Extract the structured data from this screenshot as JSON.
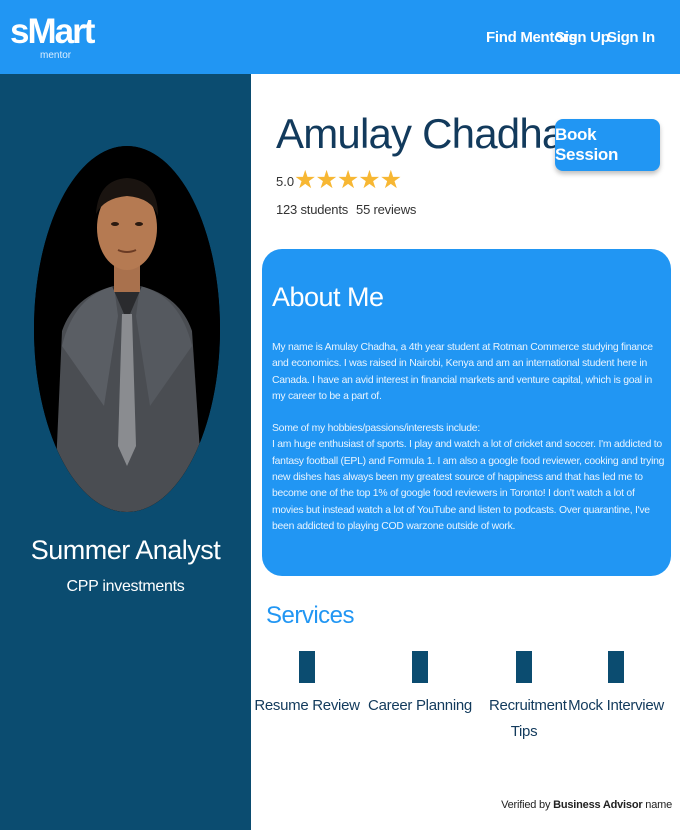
{
  "brand": {
    "logo_main": "sMart",
    "logo_sub": "mentor"
  },
  "nav": {
    "find_mentors": "Find Mentors",
    "sign_up": "Sign Up",
    "sign_in": "Sign In"
  },
  "colors": {
    "primary": "#2196f3",
    "sidebar": "#0b4c70",
    "star": "#f7b733",
    "heading": "#123a5c"
  },
  "sidebar": {
    "role_title": "Summer Analyst",
    "company": "CPP investments"
  },
  "profile": {
    "name": "Amulay Chadha",
    "rating": "5.0",
    "stars": "★★★★★",
    "star_count": 5,
    "students": "123 students",
    "reviews": "55 reviews",
    "book_button": "Book Session"
  },
  "about": {
    "title": "About Me",
    "paragraph1": "My name is Amulay Chadha, a 4th year student at Rotman Commerce studying finance and economics. I was raised in Nairobi, Kenya and am an international student here in Canada. I have an avid interest in financial markets and venture capital, which is goal in my career to be a part of.",
    "paragraph2": "Some of my hobbies/passions/interests include:",
    "paragraph3": "I am huge enthusiast of sports. I play and watch a lot of cricket and soccer. I'm addicted to fantasy football (EPL) and Formula 1. I am also a google food reviewer, cooking and trying new dishes has always been my greatest source of happiness and that has led me to become one of the top 1% of google food reviewers in Toronto! I don't watch a lot of movies but instead watch a lot of YouTube and listen to podcasts. Over quarantine, I've been addicted to playing COD warzone outside of work."
  },
  "services": {
    "title": "Services",
    "items": [
      {
        "label": "Resume Review"
      },
      {
        "label": "Career Planning"
      },
      {
        "label": "Recruitment Tips"
      },
      {
        "label": "Mock Interview"
      }
    ]
  },
  "footer": {
    "prefix": "Verified by",
    "advisor": "Business Advisor",
    "suffix": "name"
  }
}
